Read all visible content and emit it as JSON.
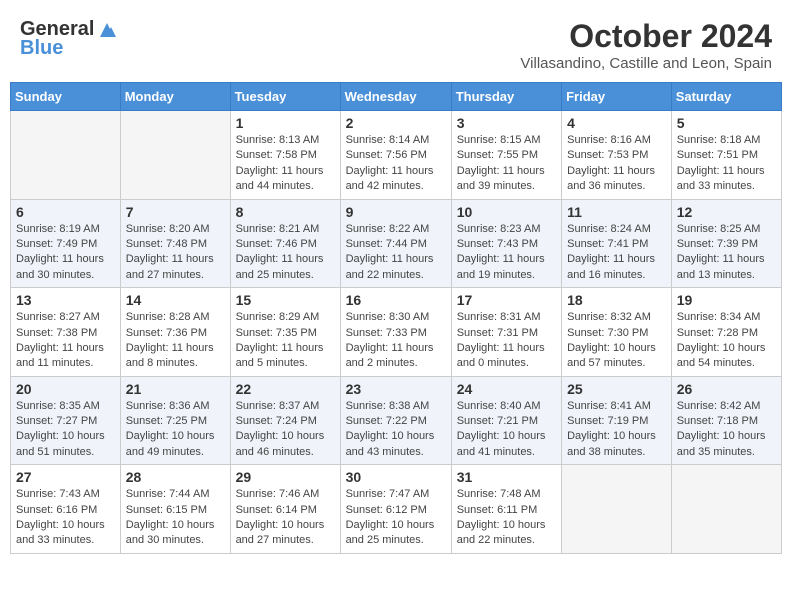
{
  "header": {
    "logo_general": "General",
    "logo_blue": "Blue",
    "month": "October 2024",
    "location": "Villasandino, Castille and Leon, Spain"
  },
  "weekdays": [
    "Sunday",
    "Monday",
    "Tuesday",
    "Wednesday",
    "Thursday",
    "Friday",
    "Saturday"
  ],
  "weeks": [
    [
      {
        "day": "",
        "info": ""
      },
      {
        "day": "",
        "info": ""
      },
      {
        "day": "1",
        "info": "Sunrise: 8:13 AM\nSunset: 7:58 PM\nDaylight: 11 hours and 44 minutes."
      },
      {
        "day": "2",
        "info": "Sunrise: 8:14 AM\nSunset: 7:56 PM\nDaylight: 11 hours and 42 minutes."
      },
      {
        "day": "3",
        "info": "Sunrise: 8:15 AM\nSunset: 7:55 PM\nDaylight: 11 hours and 39 minutes."
      },
      {
        "day": "4",
        "info": "Sunrise: 8:16 AM\nSunset: 7:53 PM\nDaylight: 11 hours and 36 minutes."
      },
      {
        "day": "5",
        "info": "Sunrise: 8:18 AM\nSunset: 7:51 PM\nDaylight: 11 hours and 33 minutes."
      }
    ],
    [
      {
        "day": "6",
        "info": "Sunrise: 8:19 AM\nSunset: 7:49 PM\nDaylight: 11 hours and 30 minutes."
      },
      {
        "day": "7",
        "info": "Sunrise: 8:20 AM\nSunset: 7:48 PM\nDaylight: 11 hours and 27 minutes."
      },
      {
        "day": "8",
        "info": "Sunrise: 8:21 AM\nSunset: 7:46 PM\nDaylight: 11 hours and 25 minutes."
      },
      {
        "day": "9",
        "info": "Sunrise: 8:22 AM\nSunset: 7:44 PM\nDaylight: 11 hours and 22 minutes."
      },
      {
        "day": "10",
        "info": "Sunrise: 8:23 AM\nSunset: 7:43 PM\nDaylight: 11 hours and 19 minutes."
      },
      {
        "day": "11",
        "info": "Sunrise: 8:24 AM\nSunset: 7:41 PM\nDaylight: 11 hours and 16 minutes."
      },
      {
        "day": "12",
        "info": "Sunrise: 8:25 AM\nSunset: 7:39 PM\nDaylight: 11 hours and 13 minutes."
      }
    ],
    [
      {
        "day": "13",
        "info": "Sunrise: 8:27 AM\nSunset: 7:38 PM\nDaylight: 11 hours and 11 minutes."
      },
      {
        "day": "14",
        "info": "Sunrise: 8:28 AM\nSunset: 7:36 PM\nDaylight: 11 hours and 8 minutes."
      },
      {
        "day": "15",
        "info": "Sunrise: 8:29 AM\nSunset: 7:35 PM\nDaylight: 11 hours and 5 minutes."
      },
      {
        "day": "16",
        "info": "Sunrise: 8:30 AM\nSunset: 7:33 PM\nDaylight: 11 hours and 2 minutes."
      },
      {
        "day": "17",
        "info": "Sunrise: 8:31 AM\nSunset: 7:31 PM\nDaylight: 11 hours and 0 minutes."
      },
      {
        "day": "18",
        "info": "Sunrise: 8:32 AM\nSunset: 7:30 PM\nDaylight: 10 hours and 57 minutes."
      },
      {
        "day": "19",
        "info": "Sunrise: 8:34 AM\nSunset: 7:28 PM\nDaylight: 10 hours and 54 minutes."
      }
    ],
    [
      {
        "day": "20",
        "info": "Sunrise: 8:35 AM\nSunset: 7:27 PM\nDaylight: 10 hours and 51 minutes."
      },
      {
        "day": "21",
        "info": "Sunrise: 8:36 AM\nSunset: 7:25 PM\nDaylight: 10 hours and 49 minutes."
      },
      {
        "day": "22",
        "info": "Sunrise: 8:37 AM\nSunset: 7:24 PM\nDaylight: 10 hours and 46 minutes."
      },
      {
        "day": "23",
        "info": "Sunrise: 8:38 AM\nSunset: 7:22 PM\nDaylight: 10 hours and 43 minutes."
      },
      {
        "day": "24",
        "info": "Sunrise: 8:40 AM\nSunset: 7:21 PM\nDaylight: 10 hours and 41 minutes."
      },
      {
        "day": "25",
        "info": "Sunrise: 8:41 AM\nSunset: 7:19 PM\nDaylight: 10 hours and 38 minutes."
      },
      {
        "day": "26",
        "info": "Sunrise: 8:42 AM\nSunset: 7:18 PM\nDaylight: 10 hours and 35 minutes."
      }
    ],
    [
      {
        "day": "27",
        "info": "Sunrise: 7:43 AM\nSunset: 6:16 PM\nDaylight: 10 hours and 33 minutes."
      },
      {
        "day": "28",
        "info": "Sunrise: 7:44 AM\nSunset: 6:15 PM\nDaylight: 10 hours and 30 minutes."
      },
      {
        "day": "29",
        "info": "Sunrise: 7:46 AM\nSunset: 6:14 PM\nDaylight: 10 hours and 27 minutes."
      },
      {
        "day": "30",
        "info": "Sunrise: 7:47 AM\nSunset: 6:12 PM\nDaylight: 10 hours and 25 minutes."
      },
      {
        "day": "31",
        "info": "Sunrise: 7:48 AM\nSunset: 6:11 PM\nDaylight: 10 hours and 22 minutes."
      },
      {
        "day": "",
        "info": ""
      },
      {
        "day": "",
        "info": ""
      }
    ]
  ]
}
